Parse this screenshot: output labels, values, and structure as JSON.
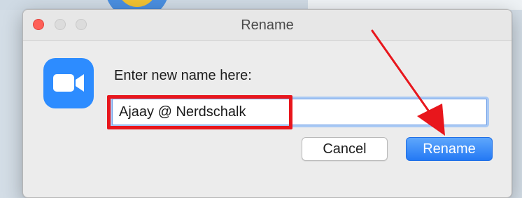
{
  "window": {
    "title": "Rename"
  },
  "dialog": {
    "prompt": "Enter new name here:",
    "input_value": "Ajaay @ Nerdschalk",
    "cancel_label": "Cancel",
    "rename_label": "Rename"
  },
  "icons": {
    "app": "zoom-camera-icon"
  },
  "colors": {
    "accent": "#2d8cff",
    "annotation": "#e8161c"
  }
}
